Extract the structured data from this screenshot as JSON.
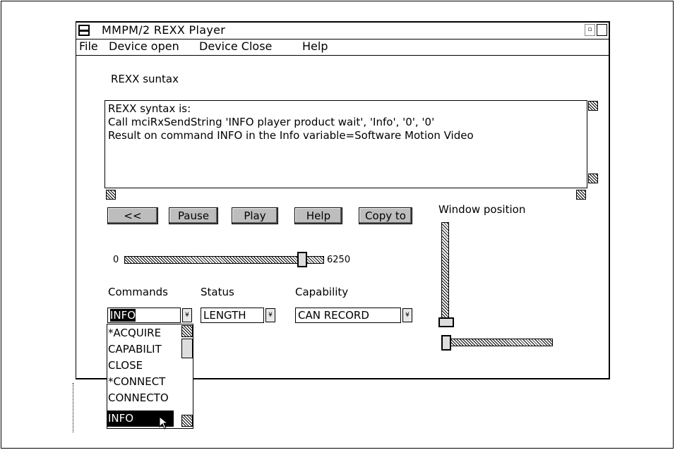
{
  "window": {
    "title": "MMPM/2 REXX Player",
    "min_glyph": "▫"
  },
  "menu": {
    "file": "File",
    "device_open": "Device open",
    "device_close": "Device Close",
    "help": "Help"
  },
  "syntax_label": "REXX suntax",
  "mle_lines": [
    "REXX syntax is:",
    "Call mciRxSendString 'INFO player product wait', 'Info', '0', '0'",
    "Result on command INFO in the Info variable=Software Motion Video"
  ],
  "buttons": {
    "rewind": "<<",
    "pause": "Pause",
    "play": "Play",
    "help": "Help",
    "copy": "Copy to"
  },
  "window_position_label": "Window position",
  "slider": {
    "min": "0",
    "max": "6250",
    "value_fraction": 0.91
  },
  "labels": {
    "commands": "Commands",
    "status": "Status",
    "capability": "Capability"
  },
  "combos": {
    "commands_value": "INFO",
    "status_value": "LENGTH",
    "capability_value": "CAN RECORD",
    "arrow_glyph": "¥"
  },
  "command_list": [
    "*ACQUIRE",
    "CAPABILIT",
    "CLOSE",
    "*CONNECT",
    "CONNECTO",
    "INFO"
  ],
  "selected_command": "INFO"
}
